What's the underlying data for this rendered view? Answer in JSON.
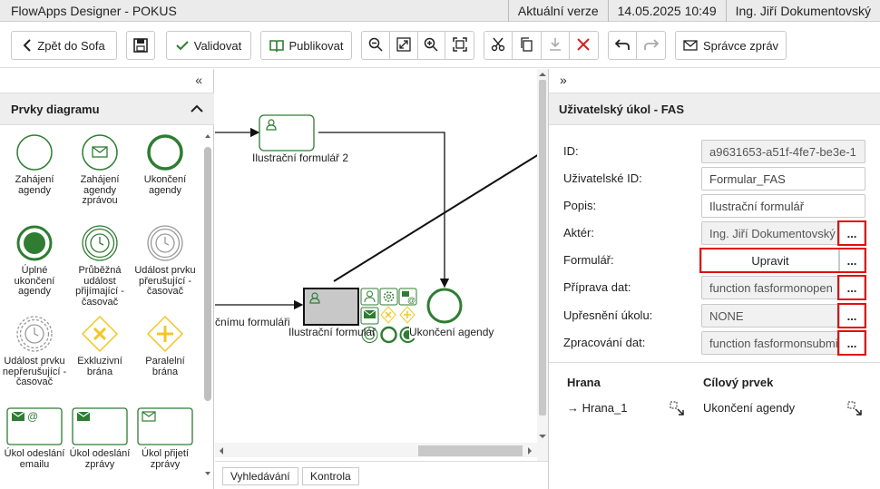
{
  "titlebar": {
    "app_title": "FlowApps Designer - POKUS",
    "version": "Aktuální verze",
    "datetime": "14.05.2025 10:49",
    "user": "Ing. Jiří Dokumentovský"
  },
  "toolbar": {
    "back_label": "Zpět do Sofa",
    "validate_label": "Validovat",
    "publish_label": "Publikovat",
    "messages_label": "Správce zpráv"
  },
  "left_panel": {
    "collapse_glyph": "«",
    "title": "Prvky diagramu",
    "items": [
      {
        "label": "Zahájení agendy",
        "icon": "start-event-icon"
      },
      {
        "label": "Zahájení agendy zprávou",
        "icon": "message-start-event-icon"
      },
      {
        "label": "Ukončení agendy",
        "icon": "end-event-icon"
      },
      {
        "label": "Úplné ukončení agendy",
        "icon": "terminate-end-event-icon"
      },
      {
        "label": "Průběžná událost přijímající - časovač",
        "icon": "timer-intermediate-event-icon"
      },
      {
        "label": "Událost prvku přerušující - časovač",
        "icon": "timer-boundary-event-icon"
      },
      {
        "label": "Událost prvku nepřerušující - časovač",
        "icon": "timer-noninterrupting-event-icon"
      },
      {
        "label": "Exkluzivní brána",
        "icon": "exclusive-gateway-icon"
      },
      {
        "label": "Paralelní brána",
        "icon": "parallel-gateway-icon"
      },
      {
        "label": "Úkol odeslání emailu",
        "icon": "send-email-task-icon"
      },
      {
        "label": "Úkol odeslání zprávy",
        "icon": "send-message-task-icon"
      },
      {
        "label": "Úkol přijetí zprávy",
        "icon": "receive-message-task-icon"
      }
    ]
  },
  "canvas": {
    "task_top_label": "Ilustrační formulář 2",
    "task_selected_label": "Ilustrační formulář",
    "end_event_label": "Ukončení agendy",
    "left_clipped_label": "čnímu formuláři"
  },
  "bottom_tabs": [
    "Vyhledávání",
    "Kontrola"
  ],
  "right_panel": {
    "collapse_glyph": "»",
    "title": "Uživatelský úkol - FAS",
    "properties": [
      {
        "label": "ID:",
        "value": "a9631653-a51f-4fe7-be3e-1"
      },
      {
        "label": "Uživatelské ID:",
        "value": "Formular_FAS"
      },
      {
        "label": "Popis:",
        "value": "Ilustrační formulář"
      },
      {
        "label": "Aktér:",
        "value": "Ing. Jiří Dokumentovský"
      },
      {
        "label": "Formulář:",
        "value": "Upravit"
      },
      {
        "label": "Příprava dat:",
        "value": "function fasformonopen"
      },
      {
        "label": "Upřesnění úkolu:",
        "value": "NONE"
      },
      {
        "label": "Zpracování dat:",
        "value": "function fasformonsubmit"
      }
    ],
    "dots_label": "...",
    "edges": {
      "col_edge": "Hrana",
      "col_target": "Cílový prvek",
      "rows": [
        {
          "edge": "→ Hrana_1",
          "target": "Ukončení agendy"
        }
      ]
    }
  },
  "colors": {
    "accent_green": "#2e7d32",
    "highlight_red": "#e01010",
    "gateway_yellow": "#f3c623"
  }
}
